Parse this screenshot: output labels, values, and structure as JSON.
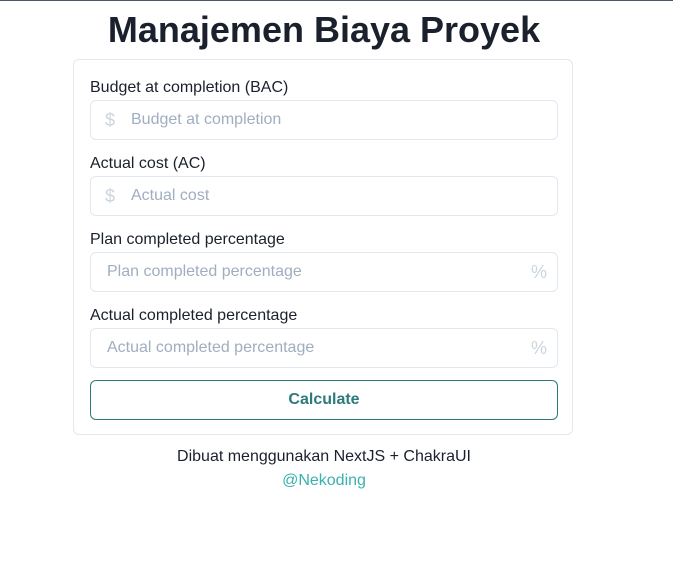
{
  "title": "Manajemen Biaya Proyek",
  "form": {
    "bac": {
      "label": "Budget at completion (BAC)",
      "placeholder": "Budget at completion",
      "value": "",
      "addon": "$"
    },
    "ac": {
      "label": "Actual cost (AC)",
      "placeholder": "Actual cost",
      "value": "",
      "addon": "$"
    },
    "plan": {
      "label": "Plan completed percentage",
      "placeholder": "Plan completed percentage",
      "value": "",
      "addon": "%"
    },
    "actual": {
      "label": "Actual completed percentage",
      "placeholder": "Actual completed percentage",
      "value": "",
      "addon": "%"
    },
    "calculate_label": "Calculate"
  },
  "footer": {
    "text": "Dibuat menggunakan NextJS + ChakraUI",
    "link_text": "@Nekoding"
  },
  "colors": {
    "accent": "#2c7a7b",
    "link": "#38b2ac",
    "border": "#e2e8f0",
    "placeholder": "#a0aec0",
    "text": "#1a202c"
  }
}
